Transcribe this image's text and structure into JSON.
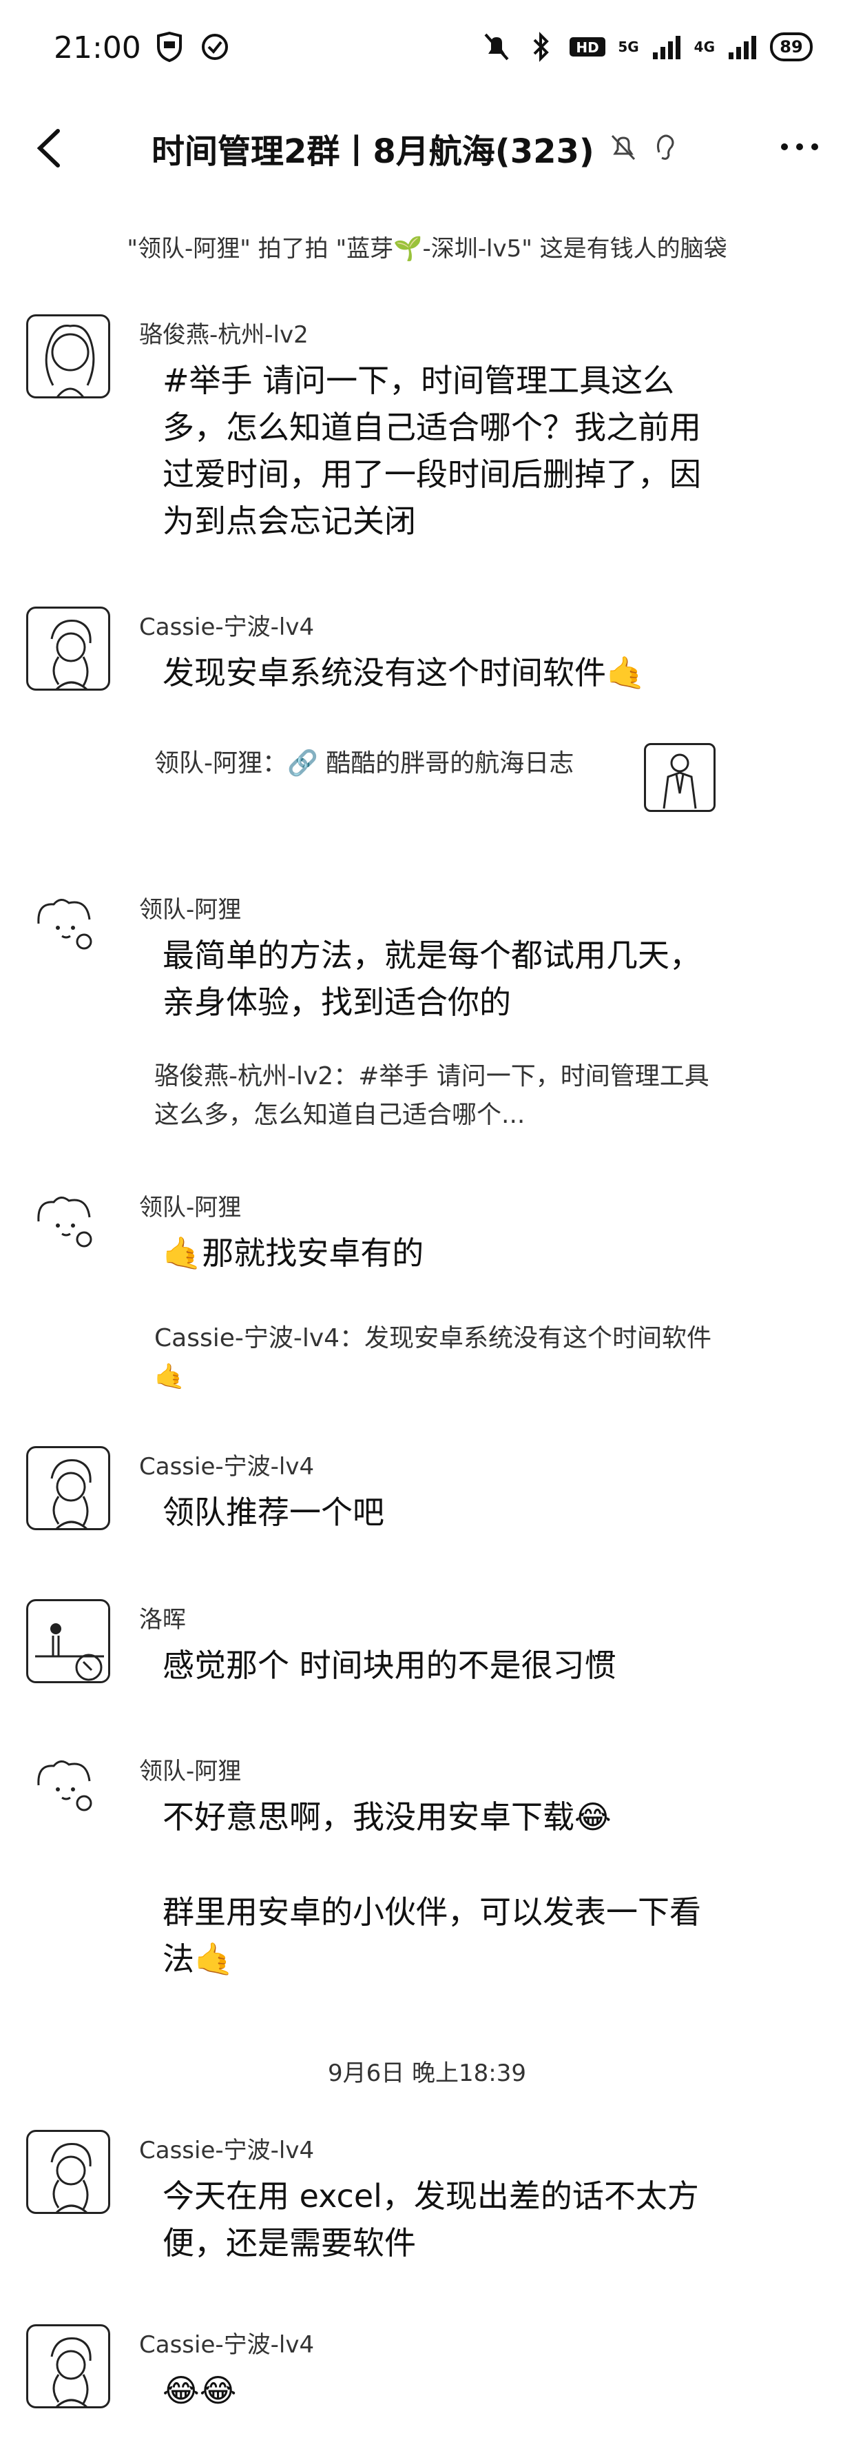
{
  "status": {
    "time": "21:00",
    "network_label": "5G",
    "network_label2": "4G",
    "battery": "89"
  },
  "header": {
    "title": "时间管理2群丨8月航海(323)"
  },
  "notice": "\"领队-阿狸\" 拍了拍 \"蓝芽🌱-深圳-lv5\" 这是有钱人的脑袋",
  "messages": [
    {
      "sender": "骆俊燕-杭州-lv2",
      "text": "#举手 请问一下，时间管理工具这么多，怎么知道自己适合哪个？我之前用过爱时间，用了一段时间后删掉了，因为到点会忘记关闭"
    },
    {
      "sender": "Cassie-宁波-lv4",
      "text": "发现安卓系统没有这个时间软件🤙",
      "quote": "领队-阿狸：🔗 酷酷的胖哥的航海日志"
    },
    {
      "sender": "领队-阿狸",
      "text": "最简单的方法，就是每个都试用几天，亲身体验，找到适合你的",
      "quote": "骆俊燕-杭州-lv2：#举手 请问一下，时间管理工具这么多，怎么知道自己适合哪个..."
    },
    {
      "sender": "领队-阿狸",
      "text": "🤙那就找安卓有的",
      "quote": "Cassie-宁波-lv4：发现安卓系统没有这个时间软件🤙"
    },
    {
      "sender": "Cassie-宁波-lv4",
      "text": "领队推荐一个吧"
    },
    {
      "sender": "洛晖",
      "text": "感觉那个 时间块用的不是很习惯"
    },
    {
      "sender": "领队-阿狸",
      "text": "不好意思啊，我没用安卓下载😂",
      "text2": "群里用安卓的小伙伴，可以发表一下看法🤙"
    }
  ],
  "datestamp": "9月6日 晚上18:39",
  "messages2": [
    {
      "sender": "Cassie-宁波-lv4",
      "text": "今天在用 excel，发现出差的话不太方便，还是需要软件"
    },
    {
      "sender": "Cassie-宁波-lv4",
      "text": "😂😂"
    }
  ]
}
